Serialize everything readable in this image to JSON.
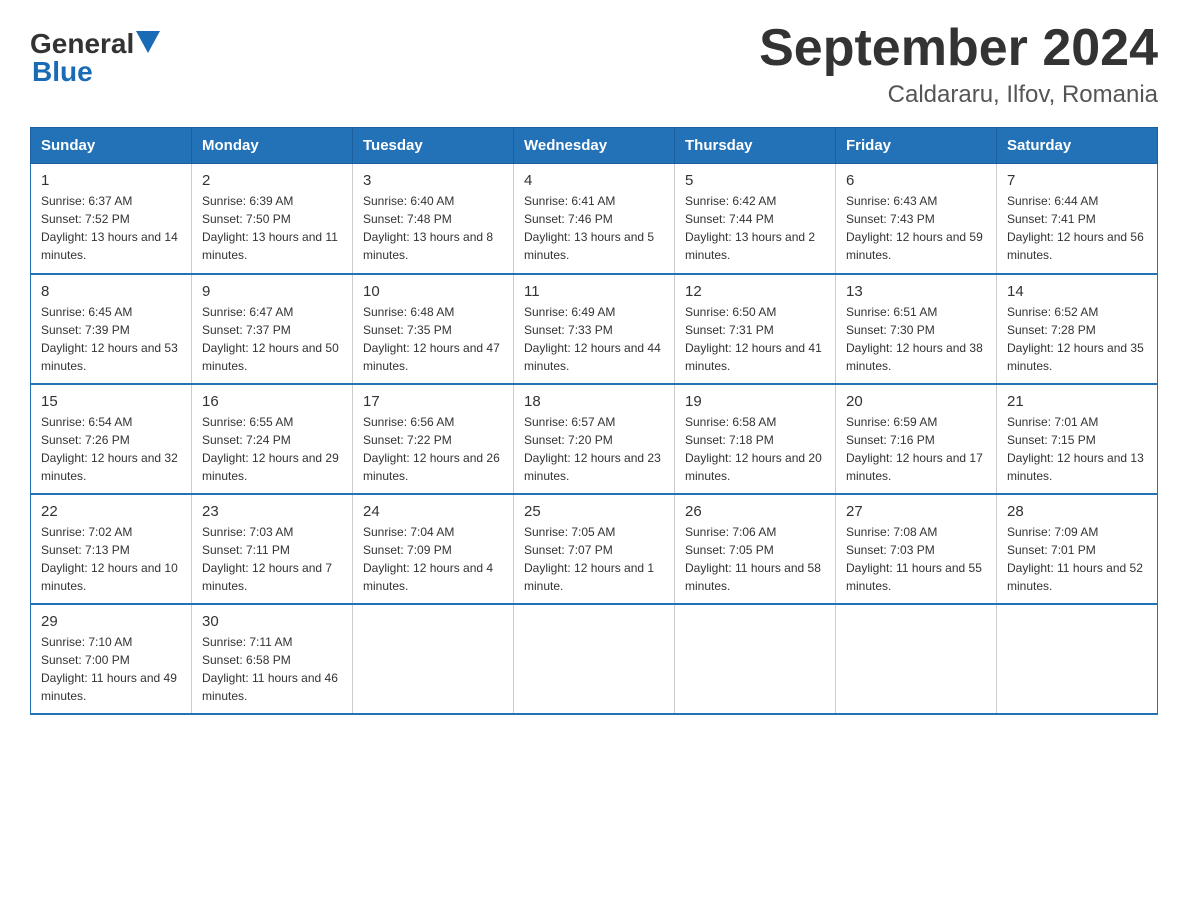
{
  "header": {
    "logo_line1": "General",
    "logo_line2": "Blue",
    "month": "September 2024",
    "location": "Caldararu, Ilfov, Romania"
  },
  "weekdays": [
    "Sunday",
    "Monday",
    "Tuesday",
    "Wednesday",
    "Thursday",
    "Friday",
    "Saturday"
  ],
  "weeks": [
    [
      {
        "day": "1",
        "sunrise": "Sunrise: 6:37 AM",
        "sunset": "Sunset: 7:52 PM",
        "daylight": "Daylight: 13 hours and 14 minutes."
      },
      {
        "day": "2",
        "sunrise": "Sunrise: 6:39 AM",
        "sunset": "Sunset: 7:50 PM",
        "daylight": "Daylight: 13 hours and 11 minutes."
      },
      {
        "day": "3",
        "sunrise": "Sunrise: 6:40 AM",
        "sunset": "Sunset: 7:48 PM",
        "daylight": "Daylight: 13 hours and 8 minutes."
      },
      {
        "day": "4",
        "sunrise": "Sunrise: 6:41 AM",
        "sunset": "Sunset: 7:46 PM",
        "daylight": "Daylight: 13 hours and 5 minutes."
      },
      {
        "day": "5",
        "sunrise": "Sunrise: 6:42 AM",
        "sunset": "Sunset: 7:44 PM",
        "daylight": "Daylight: 13 hours and 2 minutes."
      },
      {
        "day": "6",
        "sunrise": "Sunrise: 6:43 AM",
        "sunset": "Sunset: 7:43 PM",
        "daylight": "Daylight: 12 hours and 59 minutes."
      },
      {
        "day": "7",
        "sunrise": "Sunrise: 6:44 AM",
        "sunset": "Sunset: 7:41 PM",
        "daylight": "Daylight: 12 hours and 56 minutes."
      }
    ],
    [
      {
        "day": "8",
        "sunrise": "Sunrise: 6:45 AM",
        "sunset": "Sunset: 7:39 PM",
        "daylight": "Daylight: 12 hours and 53 minutes."
      },
      {
        "day": "9",
        "sunrise": "Sunrise: 6:47 AM",
        "sunset": "Sunset: 7:37 PM",
        "daylight": "Daylight: 12 hours and 50 minutes."
      },
      {
        "day": "10",
        "sunrise": "Sunrise: 6:48 AM",
        "sunset": "Sunset: 7:35 PM",
        "daylight": "Daylight: 12 hours and 47 minutes."
      },
      {
        "day": "11",
        "sunrise": "Sunrise: 6:49 AM",
        "sunset": "Sunset: 7:33 PM",
        "daylight": "Daylight: 12 hours and 44 minutes."
      },
      {
        "day": "12",
        "sunrise": "Sunrise: 6:50 AM",
        "sunset": "Sunset: 7:31 PM",
        "daylight": "Daylight: 12 hours and 41 minutes."
      },
      {
        "day": "13",
        "sunrise": "Sunrise: 6:51 AM",
        "sunset": "Sunset: 7:30 PM",
        "daylight": "Daylight: 12 hours and 38 minutes."
      },
      {
        "day": "14",
        "sunrise": "Sunrise: 6:52 AM",
        "sunset": "Sunset: 7:28 PM",
        "daylight": "Daylight: 12 hours and 35 minutes."
      }
    ],
    [
      {
        "day": "15",
        "sunrise": "Sunrise: 6:54 AM",
        "sunset": "Sunset: 7:26 PM",
        "daylight": "Daylight: 12 hours and 32 minutes."
      },
      {
        "day": "16",
        "sunrise": "Sunrise: 6:55 AM",
        "sunset": "Sunset: 7:24 PM",
        "daylight": "Daylight: 12 hours and 29 minutes."
      },
      {
        "day": "17",
        "sunrise": "Sunrise: 6:56 AM",
        "sunset": "Sunset: 7:22 PM",
        "daylight": "Daylight: 12 hours and 26 minutes."
      },
      {
        "day": "18",
        "sunrise": "Sunrise: 6:57 AM",
        "sunset": "Sunset: 7:20 PM",
        "daylight": "Daylight: 12 hours and 23 minutes."
      },
      {
        "day": "19",
        "sunrise": "Sunrise: 6:58 AM",
        "sunset": "Sunset: 7:18 PM",
        "daylight": "Daylight: 12 hours and 20 minutes."
      },
      {
        "day": "20",
        "sunrise": "Sunrise: 6:59 AM",
        "sunset": "Sunset: 7:16 PM",
        "daylight": "Daylight: 12 hours and 17 minutes."
      },
      {
        "day": "21",
        "sunrise": "Sunrise: 7:01 AM",
        "sunset": "Sunset: 7:15 PM",
        "daylight": "Daylight: 12 hours and 13 minutes."
      }
    ],
    [
      {
        "day": "22",
        "sunrise": "Sunrise: 7:02 AM",
        "sunset": "Sunset: 7:13 PM",
        "daylight": "Daylight: 12 hours and 10 minutes."
      },
      {
        "day": "23",
        "sunrise": "Sunrise: 7:03 AM",
        "sunset": "Sunset: 7:11 PM",
        "daylight": "Daylight: 12 hours and 7 minutes."
      },
      {
        "day": "24",
        "sunrise": "Sunrise: 7:04 AM",
        "sunset": "Sunset: 7:09 PM",
        "daylight": "Daylight: 12 hours and 4 minutes."
      },
      {
        "day": "25",
        "sunrise": "Sunrise: 7:05 AM",
        "sunset": "Sunset: 7:07 PM",
        "daylight": "Daylight: 12 hours and 1 minute."
      },
      {
        "day": "26",
        "sunrise": "Sunrise: 7:06 AM",
        "sunset": "Sunset: 7:05 PM",
        "daylight": "Daylight: 11 hours and 58 minutes."
      },
      {
        "day": "27",
        "sunrise": "Sunrise: 7:08 AM",
        "sunset": "Sunset: 7:03 PM",
        "daylight": "Daylight: 11 hours and 55 minutes."
      },
      {
        "day": "28",
        "sunrise": "Sunrise: 7:09 AM",
        "sunset": "Sunset: 7:01 PM",
        "daylight": "Daylight: 11 hours and 52 minutes."
      }
    ],
    [
      {
        "day": "29",
        "sunrise": "Sunrise: 7:10 AM",
        "sunset": "Sunset: 7:00 PM",
        "daylight": "Daylight: 11 hours and 49 minutes."
      },
      {
        "day": "30",
        "sunrise": "Sunrise: 7:11 AM",
        "sunset": "Sunset: 6:58 PM",
        "daylight": "Daylight: 11 hours and 46 minutes."
      },
      null,
      null,
      null,
      null,
      null
    ]
  ]
}
